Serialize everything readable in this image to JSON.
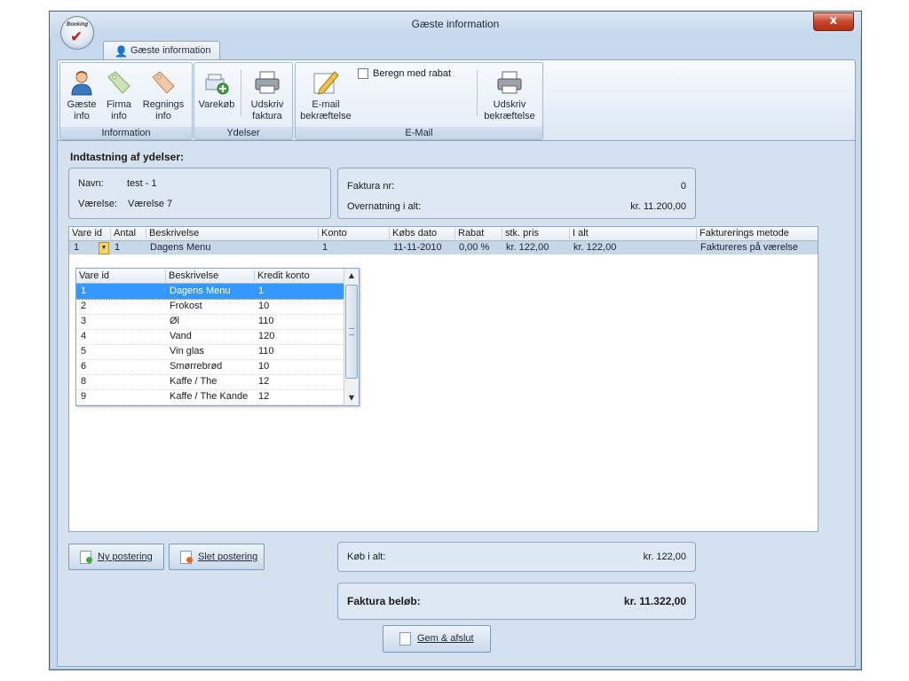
{
  "window": {
    "title": "Gæste information",
    "close_glyph": "x",
    "app_logo_text": "Booking"
  },
  "ribbon": {
    "tab_label": "Gæste information",
    "groups": {
      "information": {
        "label": "Information",
        "buttons": [
          {
            "label": "Gæste\ninfo",
            "icon": "person-icon"
          },
          {
            "label": "Firma\ninfo",
            "icon": "tag-icon"
          },
          {
            "label": "Regnings\ninfo",
            "icon": "tag-icon"
          }
        ]
      },
      "ydelser": {
        "label": "Ydelser",
        "buttons": [
          {
            "label": "Varekøb",
            "icon": "add-item-icon"
          },
          {
            "label": "Udskriv\nfaktura",
            "icon": "printer-icon"
          }
        ]
      },
      "email": {
        "label": "E-Mail",
        "buttons": [
          {
            "label": "E-mail\nbekræftelse",
            "icon": "edit-icon"
          },
          {
            "label": "Udskriv\nbekræftelse",
            "icon": "printer-icon"
          }
        ],
        "checkbox_label": "Beregn med rabat",
        "checkbox_checked": false
      }
    }
  },
  "main": {
    "section_title": "Indtastning af ydelser:",
    "guest": {
      "name_label": "Navn:",
      "name_value": "test - 1",
      "room_label": "Værelse:",
      "room_value": "Værelse 7"
    },
    "invoice": {
      "number_label": "Faktura nr:",
      "number_value": "0",
      "overnight_label": "Overnatning i alt:",
      "overnight_value": "kr. 11.200,00"
    },
    "grid": {
      "columns": [
        "Vare id",
        "Antal",
        "Beskrivelse",
        "Konto",
        "Købs dato",
        "Rabat",
        "stk. pris",
        "I alt",
        "Fakturerings metode"
      ],
      "row": {
        "vare_id": "1",
        "antal": "1",
        "beskrivelse": "Dagens Menu",
        "konto": "1",
        "dato": "11-11-2010",
        "rabat": "0,00 %",
        "stk_pris": "kr. 122,00",
        "i_alt": "kr. 122,00",
        "metode": "Faktureres på værelse"
      }
    },
    "dropdown": {
      "columns": [
        "Vare id",
        "Beskrivelse",
        "Kredit konto"
      ],
      "selected_index": 0,
      "rows": [
        {
          "id": "1",
          "desc": "Dagens Menu",
          "account": "1"
        },
        {
          "id": "2",
          "desc": "Frokost",
          "account": "10"
        },
        {
          "id": "3",
          "desc": "Øl",
          "account": "110"
        },
        {
          "id": "4",
          "desc": "Vand",
          "account": "120"
        },
        {
          "id": "5",
          "desc": "Vin glas",
          "account": "110"
        },
        {
          "id": "6",
          "desc": "Smørrebrød",
          "account": "10"
        },
        {
          "id": "8",
          "desc": "Kaffe / The",
          "account": "12"
        },
        {
          "id": "9",
          "desc": "Kaffe / The Kande",
          "account": "12"
        }
      ]
    },
    "buttons": {
      "new_label": "Ny postering",
      "delete_label": "Slet postering",
      "save_label": "Gem & afslut"
    },
    "totals": {
      "purchase_label": "Køb i alt:",
      "purchase_value": "kr. 122,00",
      "invoice_label": "Faktura beløb:",
      "invoice_value": "kr. 11.322,00"
    }
  },
  "colors": {
    "selection": "#3399ff",
    "row_highlight": "#c6d7ea",
    "window_frame": "#c7d9ec"
  }
}
